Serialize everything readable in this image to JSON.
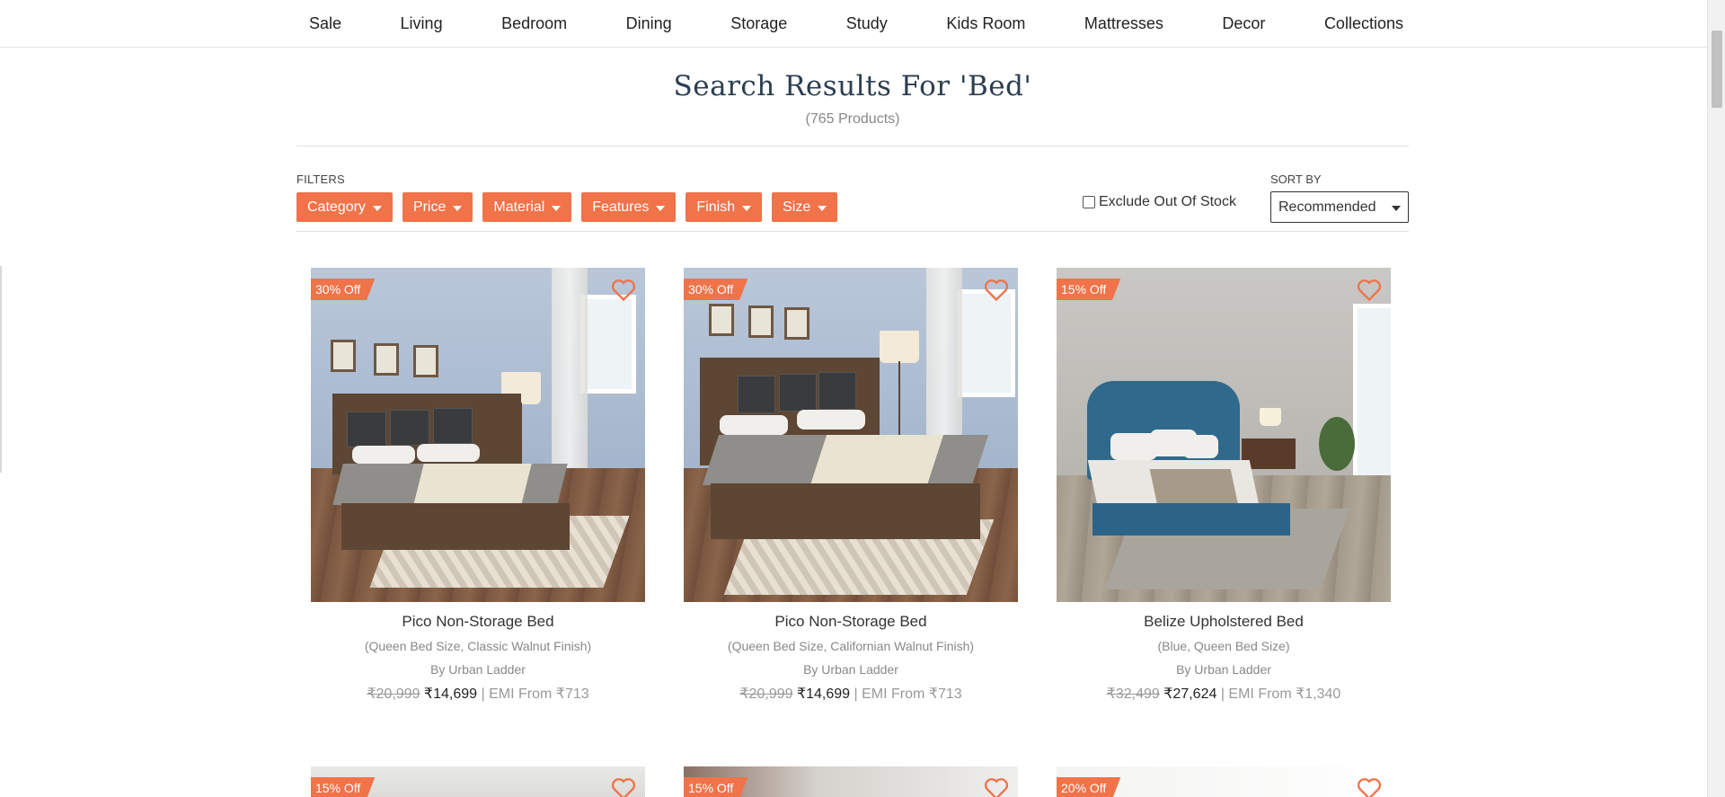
{
  "nav": [
    "Sale",
    "Living",
    "Bedroom",
    "Dining",
    "Storage",
    "Study",
    "Kids Room",
    "Mattresses",
    "Decor",
    "Collections"
  ],
  "search": {
    "title": "Search Results For 'Bed'",
    "count": "(765 Products)"
  },
  "filters": {
    "label": "FILTERS",
    "buttons": [
      "Category",
      "Price",
      "Material",
      "Features",
      "Finish",
      "Size"
    ],
    "exclude_out_of_stock": {
      "label": "Exclude Out Of Stock",
      "checked": false
    }
  },
  "sort": {
    "label": "SORT BY",
    "selected": "Recommended"
  },
  "products": [
    {
      "badge": "30% Off",
      "title": "Pico Non-Storage Bed",
      "variant": "(Queen Bed Size, Classic Walnut Finish)",
      "brand": "By Urban Ladder",
      "old_price": "₹20,999",
      "new_price": "₹14,699",
      "emi": "| EMI From ₹713"
    },
    {
      "badge": "30% Off",
      "title": "Pico Non-Storage Bed",
      "variant": "(Queen Bed Size, Californian Walnut Finish)",
      "brand": "By Urban Ladder",
      "old_price": "₹20,999",
      "new_price": "₹14,699",
      "emi": "| EMI From ₹713"
    },
    {
      "badge": "15% Off",
      "title": "Belize Upholstered Bed",
      "variant": "(Blue, Queen Bed Size)",
      "brand": "By Urban Ladder",
      "old_price": "₹32,499",
      "new_price": "₹27,624",
      "emi": "| EMI From ₹1,340"
    }
  ],
  "next_row_badges": [
    "15% Off",
    "15% Off",
    "20% Off"
  ],
  "colors": {
    "accent": "#f0734a",
    "heading": "#2c3e50"
  }
}
